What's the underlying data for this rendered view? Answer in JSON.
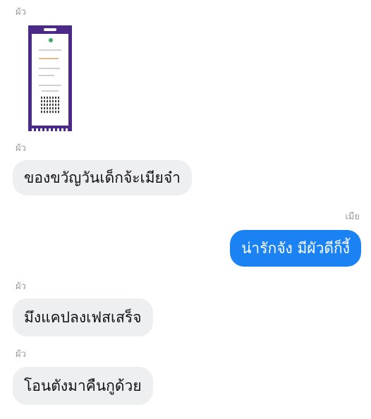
{
  "messages": [
    {
      "sender": "ผัว",
      "type": "image"
    },
    {
      "sender": "ผัว",
      "text": "ของขวัญวันเด็กจ้ะเมียจ๋า"
    },
    {
      "sender": "เมีย",
      "text": "น่ารักจัง มีผัวดีก็งี้"
    },
    {
      "sender": "ผัว",
      "text": "มึงแคปลงเฟสเสร็จ"
    },
    {
      "sender": "ผัว",
      "text": "โอนตังมาคืนกูด้วย"
    }
  ],
  "colors": {
    "incoming_bubble": "#eeeff1",
    "outgoing_bubble": "#1a82f3",
    "receipt_frame": "#4a2a86"
  }
}
